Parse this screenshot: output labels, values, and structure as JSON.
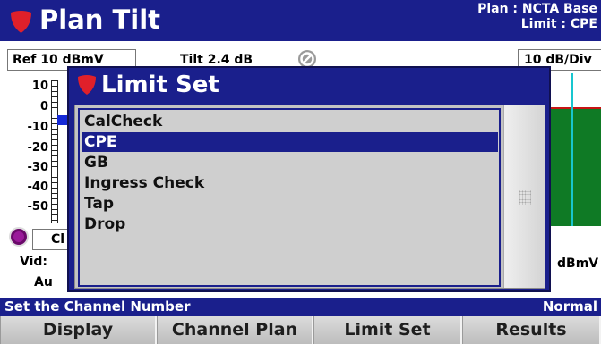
{
  "title_bar": {
    "title": "Plan Tilt",
    "plan_line": "Plan : NCTA Base",
    "limit_line": "Limit : CPE"
  },
  "toolbar": {
    "ref": "Ref 10 dBmV",
    "tilt": "Tilt 2.4 dB",
    "scale": "10 dB/Div"
  },
  "y_axis": {
    "ticks": [
      "10",
      "0",
      "-10",
      "-20",
      "-30",
      "-40",
      "-50"
    ]
  },
  "channel_panel": {
    "channel_value": "Cl",
    "vid_label": "Vid:",
    "au_label": "Au",
    "unit_label": "dBmV"
  },
  "dialog": {
    "title": "Limit Set",
    "items": [
      "CalCheck",
      "CPE",
      "GB",
      "Ingress Check",
      "Tap",
      "Drop"
    ],
    "selected": "CPE"
  },
  "status_bar": {
    "message": "Set the Channel Number",
    "mode": "Normal"
  },
  "softkeys": [
    "Display",
    "Channel Plan",
    "Limit Set",
    "Results"
  ],
  "colors": {
    "header_blue": "#1a1f8c",
    "logo_red": "#e0202a",
    "chart_green": "#0f7a25",
    "marker_cyan": "#18c6cf",
    "marker_blue": "#1428d8",
    "limit_red": "#c81414",
    "indicator_purple": "#9a1a9a"
  },
  "icons": {
    "title_icon": "shield-logo-icon",
    "dialog_icon": "shield-logo-icon",
    "no_icon": "prohibited-icon"
  }
}
